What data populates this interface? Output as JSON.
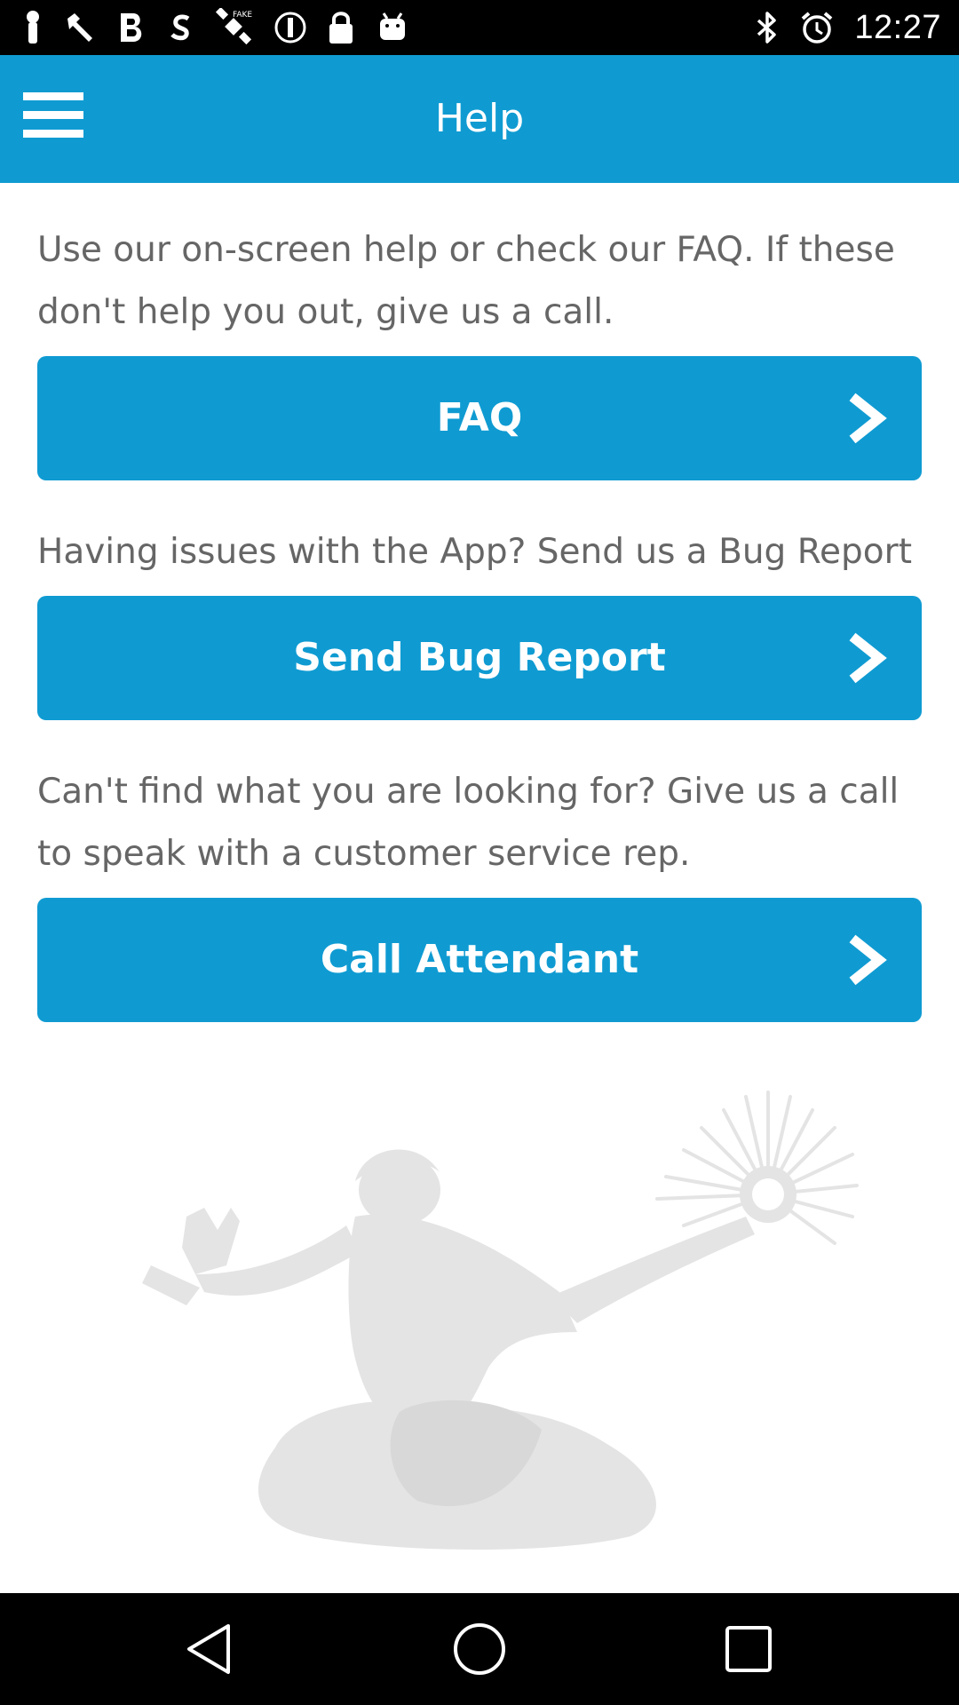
{
  "status_bar": {
    "time": "12:27",
    "icons_left": [
      "notification-icon",
      "wrench-icon",
      "bold-b-icon",
      "sirius-icon",
      "satellite-icon",
      "alert-circle-icon",
      "lock-icon",
      "android-icon"
    ],
    "icons_right": [
      "bluetooth-icon",
      "alarm-icon"
    ]
  },
  "app_bar": {
    "title": "Help",
    "menu_icon": "hamburger-menu-icon",
    "color": "#0f9bd2"
  },
  "sections": [
    {
      "text": "Use our on-screen help or check our FAQ.  If these don't help you out, give us a call.",
      "button_label": "FAQ"
    },
    {
      "text": "Having issues with the App? Send us a Bug Report",
      "button_label": "Send Bug Report"
    },
    {
      "text": "Can't find what you are looking for? Give us a call to speak with a customer service rep.",
      "button_label": "Call Attendant"
    }
  ],
  "decoration": {
    "icon": "spirit-of-detroit-statue-watermark"
  },
  "nav_bar": {
    "back_icon": "back-triangle-icon",
    "home_icon": "home-circle-icon",
    "recents_icon": "recents-square-icon"
  }
}
